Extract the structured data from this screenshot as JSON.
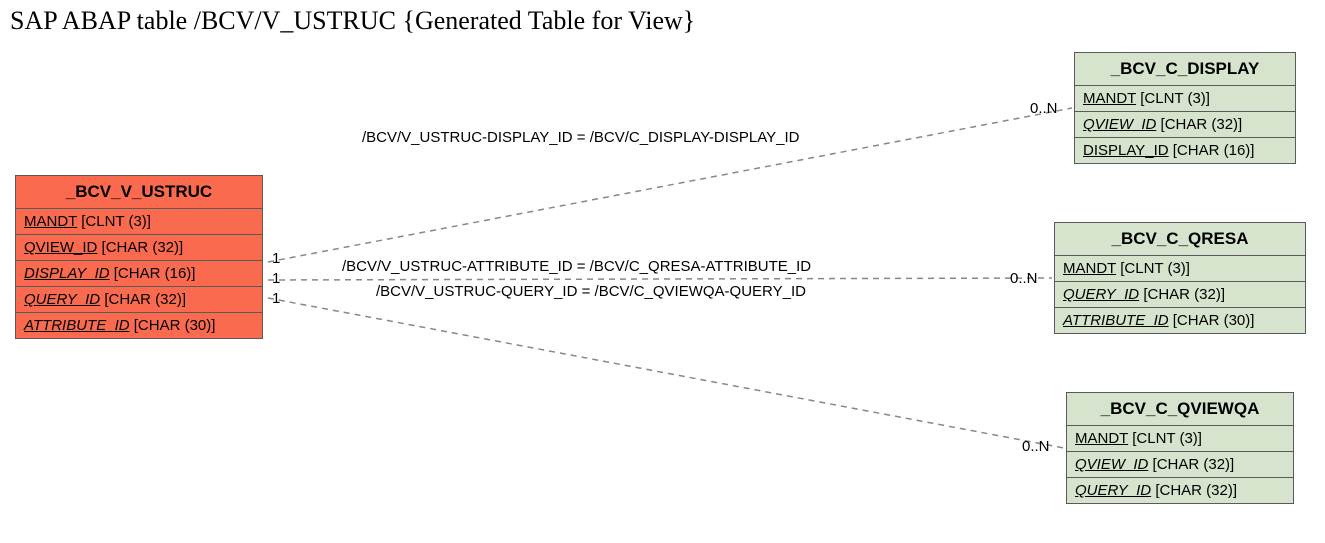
{
  "title": "SAP ABAP table /BCV/V_USTRUC {Generated Table for View}",
  "entities": {
    "ustruc": {
      "header": "_BCV_V_USTRUC",
      "rows": [
        {
          "key": "MANDT",
          "type": "[CLNT (3)]",
          "underline": true,
          "italic": false
        },
        {
          "key": "QVIEW_ID",
          "type": "[CHAR (32)]",
          "underline": true,
          "italic": false
        },
        {
          "key": "DISPLAY_ID",
          "type": "[CHAR (16)]",
          "underline": true,
          "italic": true
        },
        {
          "key": "QUERY_ID",
          "type": "[CHAR (32)]",
          "underline": true,
          "italic": true
        },
        {
          "key": "ATTRIBUTE_ID",
          "type": "[CHAR (30)]",
          "underline": true,
          "italic": true
        }
      ]
    },
    "display": {
      "header": "_BCV_C_DISPLAY",
      "rows": [
        {
          "key": "MANDT",
          "type": "[CLNT (3)]",
          "underline": true,
          "italic": false
        },
        {
          "key": "QVIEW_ID",
          "type": "[CHAR (32)]",
          "underline": true,
          "italic": true
        },
        {
          "key": "DISPLAY_ID",
          "type": "[CHAR (16)]",
          "underline": true,
          "italic": false
        }
      ]
    },
    "qresa": {
      "header": "_BCV_C_QRESA",
      "rows": [
        {
          "key": "MANDT",
          "type": "[CLNT (3)]",
          "underline": true,
          "italic": false
        },
        {
          "key": "QUERY_ID",
          "type": "[CHAR (32)]",
          "underline": true,
          "italic": true
        },
        {
          "key": "ATTRIBUTE_ID",
          "type": "[CHAR (30)]",
          "underline": true,
          "italic": true
        }
      ]
    },
    "qviewqa": {
      "header": "_BCV_C_QVIEWQA",
      "rows": [
        {
          "key": "MANDT",
          "type": "[CLNT (3)]",
          "underline": true,
          "italic": false
        },
        {
          "key": "QVIEW_ID",
          "type": "[CHAR (32)]",
          "underline": true,
          "italic": true
        },
        {
          "key": "QUERY_ID",
          "type": "[CHAR (32)]",
          "underline": true,
          "italic": true
        }
      ]
    }
  },
  "relations": {
    "r1": "/BCV/V_USTRUC-DISPLAY_ID = /BCV/C_DISPLAY-DISPLAY_ID",
    "r2": "/BCV/V_USTRUC-ATTRIBUTE_ID = /BCV/C_QRESA-ATTRIBUTE_ID",
    "r3": "/BCV/V_USTRUC-QUERY_ID = /BCV/C_QVIEWQA-QUERY_ID"
  },
  "cardinalities": {
    "left1": "1",
    "left2": "1",
    "left3": "1",
    "right1": "0..N",
    "right2": "0..N",
    "right3": "0..N"
  }
}
